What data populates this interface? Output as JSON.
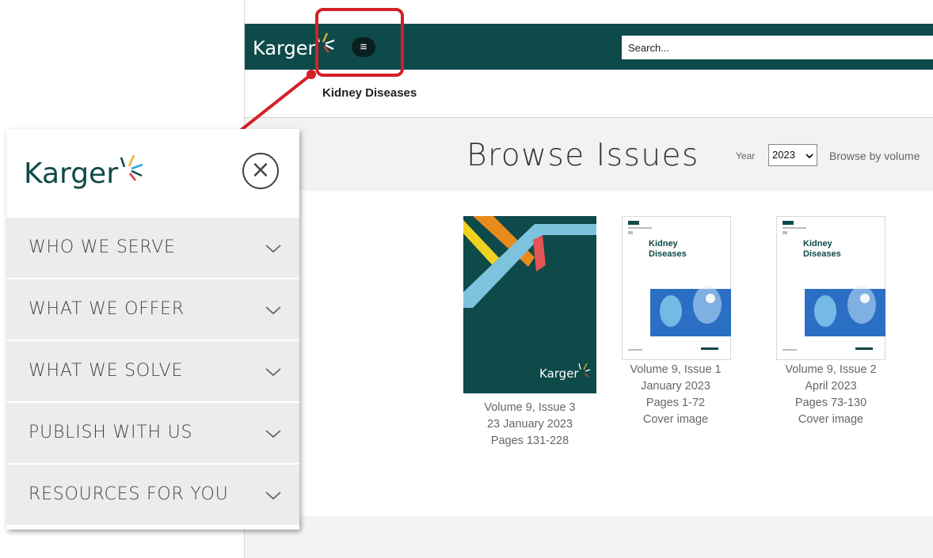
{
  "site": {
    "brand": "Karger",
    "search": {
      "placeholder": "Search..."
    },
    "menu_icon": "hamburger-menu-icon"
  },
  "journal": {
    "title": "Kidney Diseases"
  },
  "browse": {
    "title": "Browse Issues",
    "year_label": "Year",
    "year_selected": "2023",
    "browse_by": "Browse by volume"
  },
  "issues": [
    {
      "volume": "Volume 9, Issue 3",
      "date": "23 January 2023",
      "pages": "Pages 131-228",
      "cover_brand": "Karger"
    },
    {
      "volume": "Volume 9, Issue 1",
      "date": "January 2023",
      "pages": "Pages 1-72",
      "cover_link": "Cover image",
      "cover_title_line1": "Kidney",
      "cover_title_line2": "Diseases"
    },
    {
      "volume": "Volume 9, Issue 2",
      "date": "April 2023",
      "pages": "Pages 73-130",
      "cover_link": "Cover image",
      "cover_title_line1": "Kidney",
      "cover_title_line2": "Diseases"
    }
  ],
  "menu_panel": {
    "brand": "Karger",
    "items": [
      {
        "label": "WHO WE SERVE"
      },
      {
        "label": "WHAT WE OFFER"
      },
      {
        "label": "WHAT WE SOLVE"
      },
      {
        "label": "PUBLISH WITH US"
      },
      {
        "label": "RESOURCES FOR YOU"
      }
    ]
  },
  "colors": {
    "brand_teal": "#0e4a49",
    "highlight_red": "#d32027",
    "menu_bg": "#ececec",
    "browse_band": "#f2f2f2"
  }
}
